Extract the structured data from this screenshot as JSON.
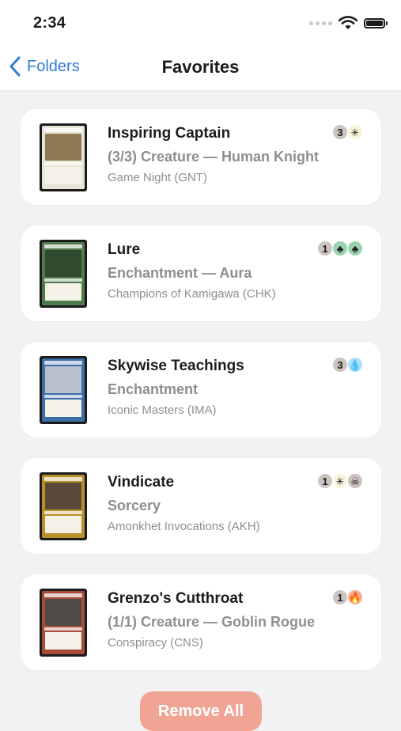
{
  "status_bar": {
    "time": "2:34"
  },
  "nav": {
    "back_label": "Folders",
    "title": "Favorites"
  },
  "cards": [
    {
      "name": "Inspiring Captain",
      "type_line": "(3/3) Creature — Human Knight",
      "set": "Game Night (GNT)",
      "mana": [
        {
          "symbol": "3",
          "color": "generic"
        },
        {
          "symbol": "✳",
          "color": "W"
        }
      ],
      "frame_color": "#e8e4d6",
      "art_color": "#8d7a55"
    },
    {
      "name": "Lure",
      "type_line": "Enchantment — Aura",
      "set": "Champions of Kamigawa (CHK)",
      "mana": [
        {
          "symbol": "1",
          "color": "generic"
        },
        {
          "symbol": "♣",
          "color": "G"
        },
        {
          "symbol": "♣",
          "color": "G"
        }
      ],
      "frame_color": "#4f7a4a",
      "art_color": "#2f4a2e"
    },
    {
      "name": "Skywise Teachings",
      "type_line": "Enchantment",
      "set": "Iconic Masters (IMA)",
      "mana": [
        {
          "symbol": "3",
          "color": "generic"
        },
        {
          "symbol": "💧",
          "color": "U"
        }
      ],
      "frame_color": "#3d6ea8",
      "art_color": "#b8c2cc"
    },
    {
      "name": "Vindicate",
      "type_line": "Sorcery",
      "set": "Amonkhet Invocations (AKH)",
      "mana": [
        {
          "symbol": "1",
          "color": "generic"
        },
        {
          "symbol": "✳",
          "color": "W"
        },
        {
          "symbol": "☠",
          "color": "B"
        }
      ],
      "frame_color": "#b8902c",
      "art_color": "#5a4a3a"
    },
    {
      "name": "Grenzo's Cutthroat",
      "type_line": "(1/1) Creature — Goblin Rogue",
      "set": "Conspiracy (CNS)",
      "mana": [
        {
          "symbol": "1",
          "color": "generic"
        },
        {
          "symbol": "🔥",
          "color": "R"
        }
      ],
      "frame_color": "#a84b38",
      "art_color": "#4e4a48"
    }
  ],
  "footer": {
    "remove_all_label": "Remove All"
  }
}
